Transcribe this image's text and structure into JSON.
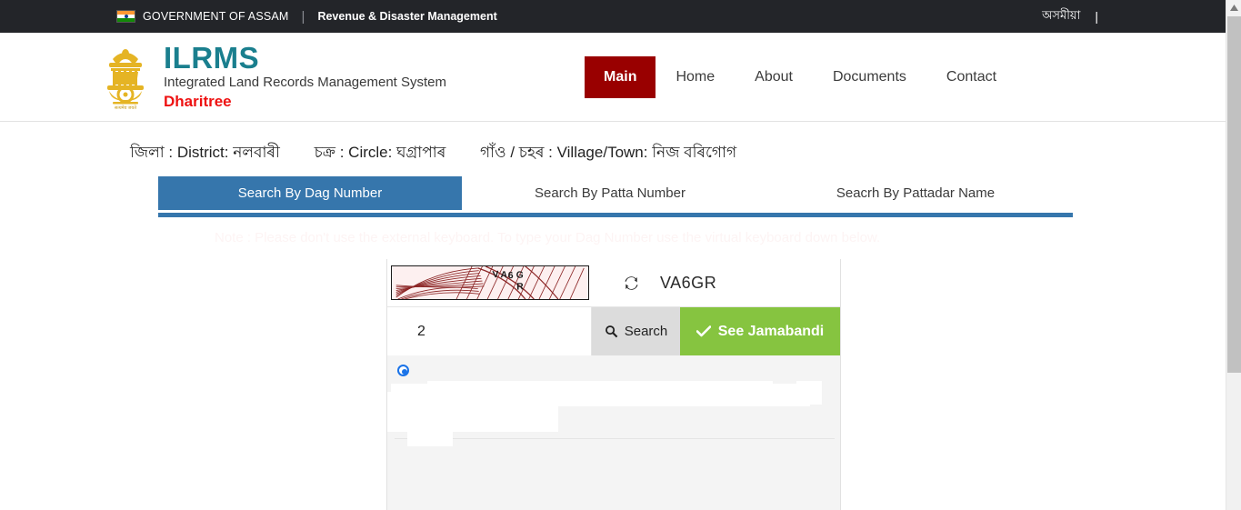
{
  "topbar": {
    "flag_icon": "india-flag-icon",
    "government": "GOVERNMENT OF ASSAM",
    "separator": "|",
    "department": "Revenue & Disaster Management",
    "language_link": "অসমীয়া",
    "right_separator": "|"
  },
  "header": {
    "emblem_icon": "india-national-emblem-icon",
    "title": "ILRMS",
    "subtitle": "Integrated Land Records Management System",
    "tagline": "Dharitree",
    "accent_teal": "#1a7f8e",
    "accent_red": "#ee1111",
    "nav": [
      {
        "label": "Main",
        "active": true
      },
      {
        "label": "Home",
        "active": false
      },
      {
        "label": "About",
        "active": false
      },
      {
        "label": "Documents",
        "active": false
      },
      {
        "label": "Contact",
        "active": false
      }
    ],
    "nav_active_bg": "#990000"
  },
  "breadcrumb": {
    "district": "জিলা : District: নলবাৰী",
    "circle": "চক্ৰ : Circle: ঘগ্ৰাপাৰ",
    "village": "গাঁও / চহৰ : Village/Town: নিজ বৰিগোগ"
  },
  "tabs": {
    "active_color": "#3676ac",
    "items": [
      {
        "label": "Search By Dag Number",
        "active": true
      },
      {
        "label": "Search By Patta Number",
        "active": false
      },
      {
        "label": "Seacrh By Pattadar Name",
        "active": false
      }
    ]
  },
  "note": "Note : Please don't use the external keyboard. To type your Dag Number use the virtual keyboard down below.",
  "search_panel": {
    "captcha_image_text": "VA6GR",
    "refresh_icon": "refresh-icon",
    "captcha_code": "VA6GR",
    "dag_input_value": "2",
    "dag_input_placeholder": "",
    "search_icon": "magnifier-icon",
    "search_label": "Search",
    "jamabandi_icon": "check-icon",
    "jamabandi_label": "See Jamabandi",
    "jamabandi_color": "#86c440",
    "result_radio_selected": true,
    "radio_color": "#1a73e8"
  },
  "scrollbar": {
    "up_arrow_icon": "scroll-up-arrow-icon",
    "thumb_color": "#c1c1c1",
    "track_color": "#f1f1f1"
  }
}
